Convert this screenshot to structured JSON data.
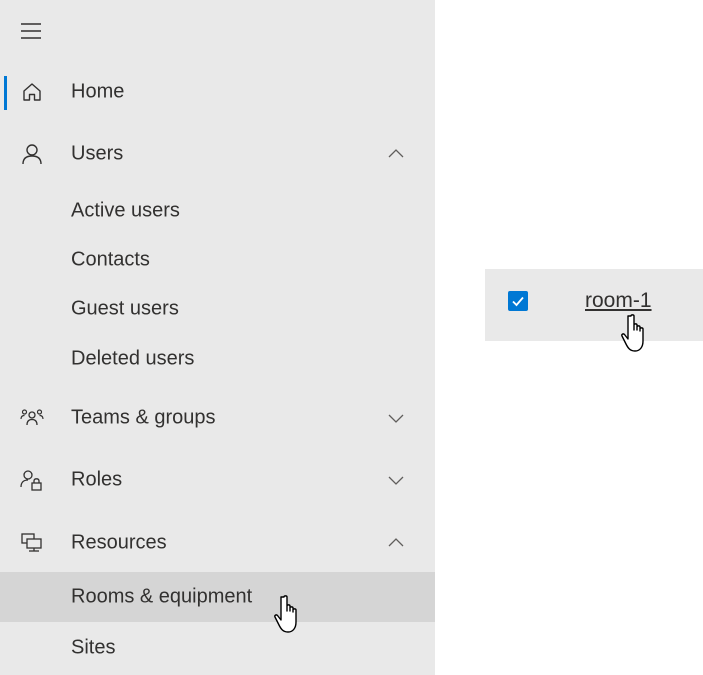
{
  "nav": {
    "menu_icon": "hamburger-icon",
    "items": [
      {
        "label": "Home",
        "icon": "home-icon"
      },
      {
        "label": "Users",
        "icon": "person-icon",
        "expanded": true
      },
      {
        "label": "Teams & groups",
        "icon": "people-team-icon",
        "expanded": false
      },
      {
        "label": "Roles",
        "icon": "person-lock-icon",
        "expanded": false
      },
      {
        "label": "Resources",
        "icon": "resources-icon",
        "expanded": true
      }
    ],
    "users_children": [
      "Active users",
      "Contacts",
      "Guest users",
      "Deleted users"
    ],
    "resources_children": [
      "Rooms & equipment",
      "Sites"
    ],
    "selected": "Rooms & equipment"
  },
  "row": {
    "checked": true,
    "name": "room-1"
  },
  "colors": {
    "nav_bg": "#e9e9e9",
    "selected_bg": "#d5d5d5",
    "accent": "#0078d4",
    "text": "#323130"
  }
}
